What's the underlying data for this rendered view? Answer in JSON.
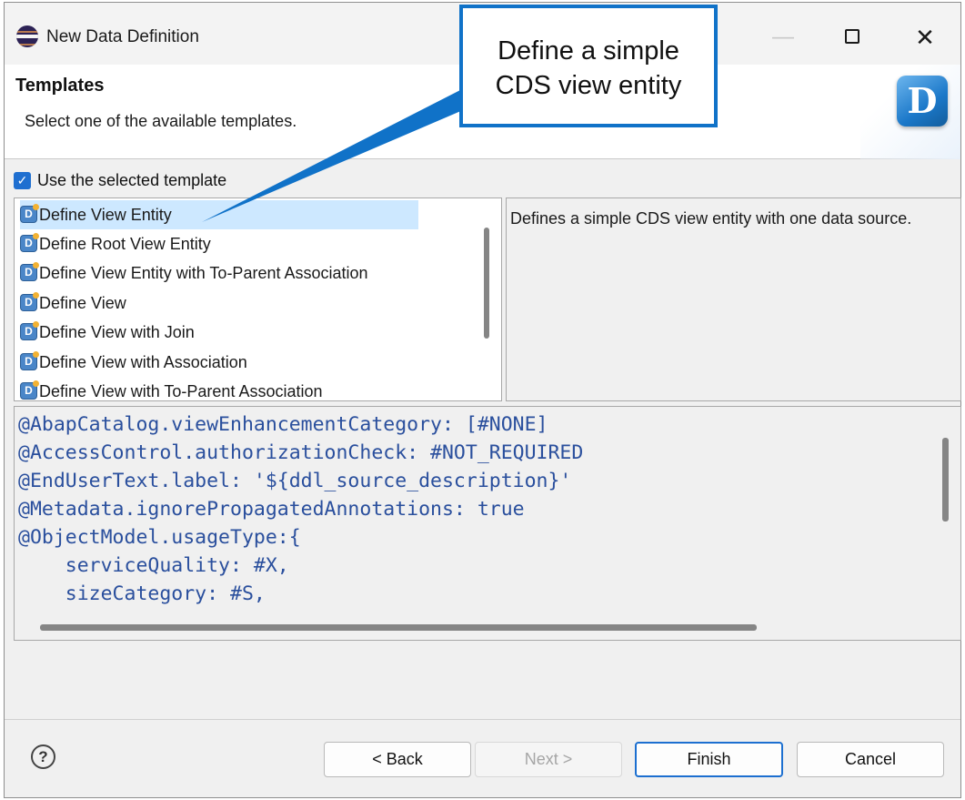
{
  "window": {
    "title": "New Data Definition",
    "minimize_glyph": "—",
    "close_glyph": "✕"
  },
  "header": {
    "title": "Templates",
    "description": "Select one of the available templates.",
    "badge_letter": "D"
  },
  "use_template": {
    "checked": true,
    "label": "Use the selected template"
  },
  "templates": {
    "selected_index": 0,
    "items": [
      {
        "label": "Define View Entity"
      },
      {
        "label": "Define Root View Entity"
      },
      {
        "label": "Define View Entity with To-Parent Association"
      },
      {
        "label": "Define View"
      },
      {
        "label": "Define View with Join"
      },
      {
        "label": "Define View with Association"
      },
      {
        "label": "Define View with To-Parent Association"
      }
    ]
  },
  "template_description": "Defines a simple CDS view entity with one data source.",
  "code_preview": {
    "lines": [
      "@AbapCatalog.viewEnhancementCategory: [#NONE]",
      "@AccessControl.authorizationCheck: #NOT_REQUIRED",
      "@EndUserText.label: '${ddl_source_description}'",
      "@Metadata.ignorePropagatedAnnotations: true",
      "@ObjectModel.usageType:{",
      "    serviceQuality: #X,",
      "    sizeCategory: #S,"
    ]
  },
  "footer": {
    "help_glyph": "?",
    "back_label": "< Back",
    "next_label": "Next >",
    "finish_label": "Finish",
    "cancel_label": "Cancel"
  },
  "callout": {
    "line1": "Define a simple",
    "line2": "CDS view entity",
    "color": "#1072c8"
  }
}
